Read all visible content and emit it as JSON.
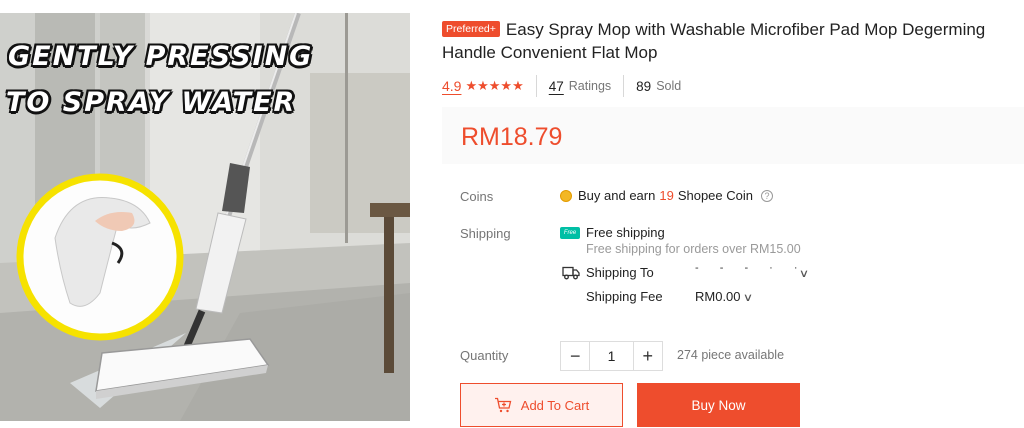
{
  "image": {
    "caption_line1": "GENTLY PRESSING",
    "caption_line2": "TO SPRAY WATER"
  },
  "product": {
    "badge": "Preferred+",
    "title": "Easy Spray Mop with Washable Microfiber Pad Mop Degerming Handle Convenient Flat Mop",
    "rating": "4.9",
    "stars": "★★★★★",
    "ratings_count": "47",
    "ratings_label": "Ratings",
    "sold_count": "89",
    "sold_label": "Sold",
    "price": "RM18.79"
  },
  "coins": {
    "label": "Coins",
    "text_before": "Buy and earn",
    "amount": "19",
    "text_after": "Shopee Coin",
    "help": "?"
  },
  "shipping": {
    "label": "Shipping",
    "free_tag": "Free",
    "free_title": "Free shipping",
    "free_sub": "Free shipping for orders over RM15.00",
    "ship_to_label": "Shipping To",
    "ship_to_value": "- - - · ·",
    "fee_label": "Shipping Fee",
    "fee_value": "RM0.00"
  },
  "quantity": {
    "label": "Quantity",
    "minus": "−",
    "value": "1",
    "plus": "+",
    "stock": "274 piece available"
  },
  "actions": {
    "add_to_cart": "Add To Cart",
    "buy_now": "Buy Now"
  },
  "colors": {
    "accent": "#ee4d2d",
    "cart_bg": "#fff1ee",
    "free_tag": "#00bfa5",
    "coin": "#f3b724"
  },
  "icons": [
    "star-icon",
    "coin-icon",
    "help-icon",
    "free-shipping-icon",
    "truck-icon",
    "chevron-down-icon",
    "cart-icon"
  ]
}
